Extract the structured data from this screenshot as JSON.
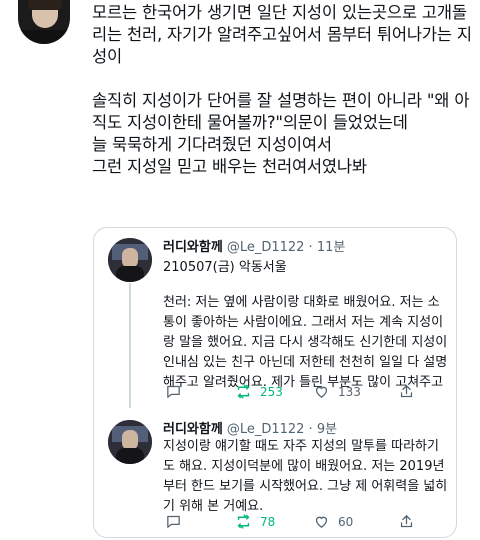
{
  "main_tweet": {
    "text": "모르는 한국어가 생기면 일단 지성이 있는곳으로 고개돌리는 천러, 자기가 알려주고싶어서 몸부터 튀어나가는 지성이\n\n솔직히 지성이가 단어를 잘 설명하는 편이 아니라 \"왜 아직도 지성이한테 물어볼까?\"의문이 들었었는데\n늘 묵묵하게 기다려줬던 지성이여서\n그런 지성일 믿고 배우는 천러여서였나봐"
  },
  "quoted_tweets": [
    {
      "display_name": "러디와함께",
      "handle_time": "@Le_D1122 · 11분",
      "subtitle": "210507(금) 악동서울",
      "body": "천러: 저는 옆에 사람이랑 대화로 배웠어요. 저는 소\n통이 좋아하는 사람이에요. 그래서 저는 계속 지성이\n랑 말을 했어요. 지금 다시 생각해도 신기한데 지성이\n인내심 있는 친구 아닌데 저한테 천천히 일일 다 설명\n해주고 알려줬어요. 제가 틀린 부분도 많이 고쳐주고",
      "retweets": "253",
      "likes": "133"
    },
    {
      "display_name": "러디와함께",
      "handle_time": "@Le_D1122 · 9분",
      "body": "지성이랑 얘기할 때도 자주 지성의 말투를 따라하기\n도 해요. 지성이덕분에 많이 배웠어요. 저는 2019년\n부터 한드 보기를 시작했어요. 그냥 제 어휘력을 넓히\n기 위해 본 거예요.",
      "retweets": "78",
      "likes": "60"
    }
  ],
  "colors": {
    "retweet_active": "#00ba7c",
    "muted": "#536471",
    "border": "#cfd9de"
  }
}
